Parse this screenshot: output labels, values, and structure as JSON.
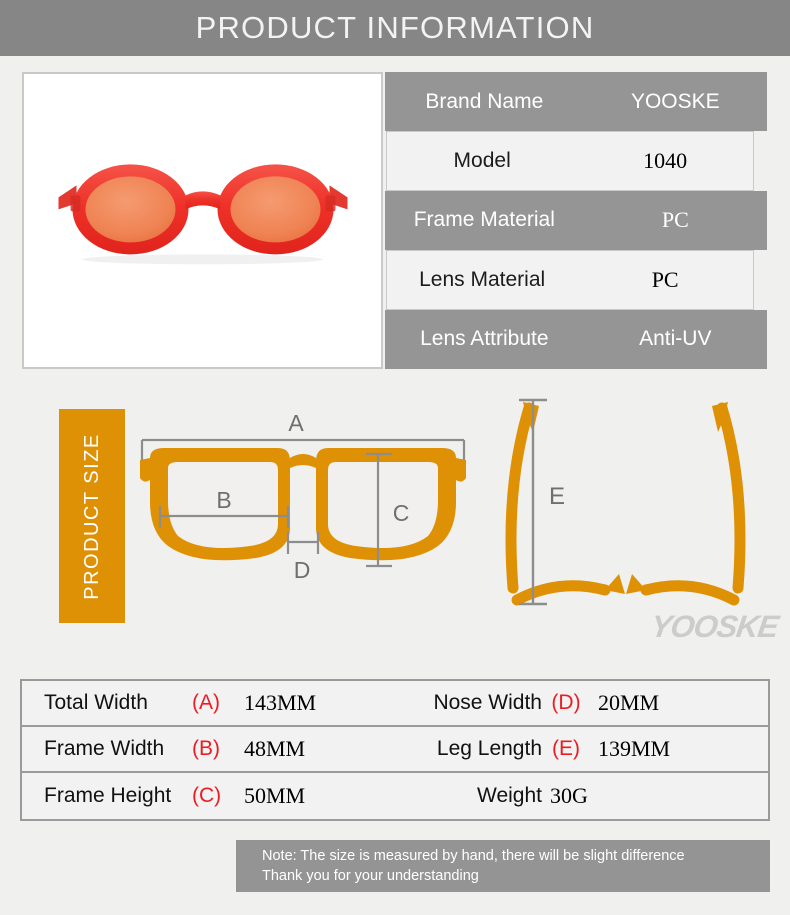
{
  "header": {
    "title": "PRODUCT INFORMATION"
  },
  "product_photo": {
    "alt": "red oval sunglasses with orange tinted lenses",
    "frame_color": "#ef3b33",
    "lens_color": "#f08a5c"
  },
  "spec_table": {
    "rows": [
      {
        "label": "Brand Name",
        "value": "YOOSKE",
        "style": "dark",
        "serif": false
      },
      {
        "label": "Model",
        "value": "1040",
        "style": "light",
        "serif": true
      },
      {
        "label": "Frame Material",
        "value": "PC",
        "style": "dark",
        "serif": true
      },
      {
        "label": "Lens Material",
        "value": "PC",
        "style": "light",
        "serif": true
      },
      {
        "label": "Lens Attribute",
        "value": "Anti-UV",
        "style": "dark",
        "serif": false
      }
    ]
  },
  "size_section": {
    "banner_label": "PRODUCT SIZE",
    "banner_color": "#df9105",
    "diagram_color": "#df9105",
    "dimension_line_color": "#8d8d8d",
    "front_labels": [
      "A",
      "B",
      "C",
      "D"
    ],
    "side_labels": [
      "E"
    ],
    "watermark": "YOOSKE"
  },
  "measure_table": {
    "rows": [
      {
        "name_left": "Total Width",
        "letter_left": "(A)",
        "value_left": "143MM",
        "name_right": "Nose Width",
        "letter_right": "(D)",
        "value_right": "20MM"
      },
      {
        "name_left": "Frame Width",
        "letter_left": "(B)",
        "value_left": "48MM",
        "name_right": "Leg Length",
        "letter_right": "(E)",
        "value_right": "139MM"
      },
      {
        "name_left": "Frame Height",
        "letter_left": "(C)",
        "value_left": "50MM",
        "name_right": "Weight",
        "letter_right": "",
        "value_right": "30G"
      }
    ]
  },
  "note": {
    "line1": "Note: The size is measured by hand, there will be slight difference",
    "line2": "Thank you for your understanding"
  }
}
